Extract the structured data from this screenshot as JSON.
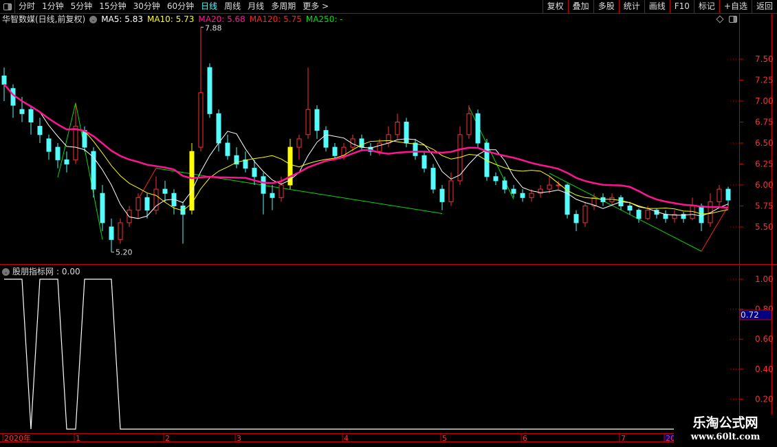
{
  "toolbar": {
    "periods": [
      "分时",
      "1分钟",
      "5分钟",
      "15分钟",
      "30分钟",
      "60分钟",
      "日线",
      "周线",
      "月线",
      "多周期",
      "更多 >"
    ],
    "active_period": "日线",
    "actions": [
      "复权",
      "叠加",
      "多股",
      "统计",
      "画线",
      "F10",
      "标记",
      "+自选",
      "返回"
    ]
  },
  "header": {
    "title": "华智数媒(日线,前复权)",
    "ma": [
      {
        "label": "MA5: 5.83",
        "color": "#ffffff"
      },
      {
        "label": "MA10: 5.73",
        "color": "#ffff00"
      },
      {
        "label": "MA20: 5.68",
        "color": "#ff1493"
      },
      {
        "label": "MA120: 5.75",
        "color": "#ff2020"
      },
      {
        "label": "MA250: -",
        "color": "#00e000"
      }
    ]
  },
  "indicator": {
    "title": "股朋指标网",
    "value": ": 0.00",
    "current_label": "0.72",
    "values": [
      1,
      1,
      1,
      0,
      1,
      1,
      1,
      0,
      0,
      1,
      1,
      1,
      1,
      0,
      0,
      0,
      0,
      0,
      0,
      0,
      0,
      0,
      0,
      0,
      0,
      0,
      0,
      0,
      0,
      0,
      0,
      0,
      0,
      0,
      0,
      0,
      0,
      0,
      0,
      0,
      0,
      0,
      0,
      0,
      0,
      0,
      0,
      0,
      0,
      0,
      0,
      0,
      0,
      0,
      0,
      0,
      0,
      0,
      0,
      0,
      0,
      0,
      0,
      0,
      0,
      0,
      0,
      0,
      0,
      0,
      0,
      0,
      0,
      0,
      0,
      0,
      0,
      0,
      0,
      0,
      0,
      0
    ],
    "ticks": [
      1.0,
      0.8,
      0.6,
      0.4,
      0.2
    ]
  },
  "chart_data": {
    "type": "candlestick",
    "price_ticks": [
      7.5,
      7.25,
      7.0,
      6.75,
      6.5,
      6.25,
      6.0,
      5.75,
      5.5
    ],
    "ylim": [
      5.08,
      7.96
    ],
    "time_labels": [
      {
        "label": "2020年",
        "i": 0
      },
      {
        "label": "1",
        "i": 8
      },
      {
        "label": "2",
        "i": 18
      },
      {
        "label": "3",
        "i": 26
      },
      {
        "label": "4",
        "i": 38
      },
      {
        "label": "5",
        "i": 49
      },
      {
        "label": "6",
        "i": 58
      },
      {
        "label": "7",
        "i": 69
      },
      {
        "label": "20",
        "i": 74
      }
    ],
    "annotations": [
      {
        "label": "7.88",
        "i": 22,
        "price": 7.88
      },
      {
        "label": "5.20",
        "i": 12,
        "price": 5.2
      }
    ],
    "highlight_candles": [
      21,
      32
    ],
    "candles": [
      [
        7.3,
        7.4,
        7.0,
        7.2
      ],
      [
        7.15,
        7.2,
        6.8,
        6.95
      ],
      [
        6.9,
        7.05,
        6.75,
        6.85
      ],
      [
        6.9,
        6.95,
        6.6,
        6.75
      ],
      [
        6.7,
        6.8,
        6.5,
        6.6
      ],
      [
        6.55,
        6.6,
        6.3,
        6.4
      ],
      [
        6.45,
        6.5,
        6.2,
        6.3
      ],
      [
        6.3,
        6.4,
        6.15,
        6.25
      ],
      [
        6.3,
        6.97,
        6.25,
        6.7
      ],
      [
        6.65,
        6.7,
        6.4,
        6.45
      ],
      [
        6.4,
        6.45,
        5.85,
        5.95
      ],
      [
        5.9,
        6.0,
        5.45,
        5.55
      ],
      [
        5.5,
        5.6,
        5.2,
        5.35
      ],
      [
        5.35,
        5.6,
        5.3,
        5.55
      ],
      [
        5.55,
        5.75,
        5.5,
        5.7
      ],
      [
        5.7,
        5.9,
        5.6,
        5.85
      ],
      [
        5.85,
        5.9,
        5.6,
        5.7
      ],
      [
        5.7,
        6.1,
        5.65,
        5.95
      ],
      [
        5.95,
        6.05,
        5.8,
        5.9
      ],
      [
        5.9,
        5.95,
        5.65,
        5.75
      ],
      [
        5.75,
        5.8,
        5.3,
        5.65
      ],
      [
        5.7,
        6.5,
        5.65,
        6.4
      ],
      [
        6.45,
        7.88,
        6.4,
        7.1
      ],
      [
        7.4,
        7.45,
        6.8,
        6.85
      ],
      [
        6.85,
        6.9,
        6.4,
        6.5
      ],
      [
        6.5,
        6.6,
        6.3,
        6.35
      ],
      [
        6.35,
        6.45,
        6.2,
        6.25
      ],
      [
        6.3,
        6.4,
        6.15,
        6.2
      ],
      [
        6.2,
        6.3,
        6.0,
        6.1
      ],
      [
        6.1,
        6.15,
        5.65,
        5.9
      ],
      [
        5.9,
        6.0,
        5.7,
        5.85
      ],
      [
        5.85,
        6.1,
        5.8,
        6.0
      ],
      [
        6.0,
        6.55,
        5.95,
        6.45
      ],
      [
        6.45,
        6.6,
        6.3,
        6.55
      ],
      [
        6.6,
        7.4,
        6.55,
        6.9
      ],
      [
        6.9,
        6.95,
        6.55,
        6.65
      ],
      [
        6.65,
        6.7,
        6.4,
        6.45
      ],
      [
        6.45,
        6.5,
        6.3,
        6.35
      ],
      [
        6.35,
        6.5,
        6.3,
        6.45
      ],
      [
        6.45,
        6.6,
        6.4,
        6.55
      ],
      [
        6.55,
        6.6,
        6.4,
        6.45
      ],
      [
        6.45,
        6.5,
        6.35,
        6.4
      ],
      [
        6.4,
        6.55,
        6.35,
        6.5
      ],
      [
        6.5,
        6.7,
        6.45,
        6.6
      ],
      [
        6.6,
        6.85,
        6.55,
        6.75
      ],
      [
        6.75,
        6.8,
        6.45,
        6.5
      ],
      [
        6.5,
        6.55,
        6.3,
        6.35
      ],
      [
        6.35,
        6.4,
        6.15,
        6.2
      ],
      [
        6.2,
        6.25,
        5.9,
        5.95
      ],
      [
        5.95,
        6.0,
        5.7,
        5.8
      ],
      [
        5.8,
        6.15,
        5.75,
        6.05
      ],
      [
        6.05,
        6.7,
        6.0,
        6.6
      ],
      [
        6.6,
        6.95,
        6.55,
        6.85
      ],
      [
        6.85,
        6.9,
        6.45,
        6.5
      ],
      [
        6.5,
        6.55,
        6.05,
        6.1
      ],
      [
        6.1,
        6.15,
        6.0,
        6.05
      ],
      [
        6.05,
        6.1,
        5.9,
        5.95
      ],
      [
        5.95,
        6.0,
        5.85,
        5.9
      ],
      [
        5.9,
        5.95,
        5.8,
        5.85
      ],
      [
        5.85,
        5.95,
        5.8,
        5.9
      ],
      [
        5.9,
        6.0,
        5.85,
        5.95
      ],
      [
        5.95,
        6.1,
        5.9,
        6.0
      ],
      [
        6.0,
        6.05,
        5.95,
        6.0
      ],
      [
        6.0,
        6.02,
        5.6,
        5.65
      ],
      [
        5.65,
        5.7,
        5.45,
        5.55
      ],
      [
        5.55,
        5.8,
        5.5,
        5.75
      ],
      [
        5.75,
        5.9,
        5.7,
        5.85
      ],
      [
        5.85,
        5.9,
        5.75,
        5.8
      ],
      [
        5.8,
        5.9,
        5.75,
        5.85
      ],
      [
        5.85,
        5.88,
        5.7,
        5.75
      ],
      [
        5.75,
        5.8,
        5.65,
        5.7
      ],
      [
        5.7,
        5.72,
        5.55,
        5.6
      ],
      [
        5.6,
        5.75,
        5.58,
        5.7
      ],
      [
        5.7,
        5.72,
        5.6,
        5.65
      ],
      [
        5.65,
        5.7,
        5.55,
        5.6
      ],
      [
        5.6,
        5.7,
        5.55,
        5.65
      ],
      [
        5.65,
        5.68,
        5.55,
        5.6
      ],
      [
        5.6,
        5.85,
        5.58,
        5.75
      ],
      [
        5.75,
        5.78,
        5.45,
        5.55
      ],
      [
        5.55,
        5.9,
        5.5,
        5.8
      ],
      [
        5.8,
        6.0,
        5.75,
        5.95
      ],
      [
        5.95,
        5.98,
        5.75,
        5.82
      ]
    ],
    "zigzag": [
      {
        "color": "#00e000",
        "points": [
          [
            6,
            6.09
          ],
          [
            8,
            6.98
          ],
          [
            11,
            5.35
          ]
        ]
      },
      {
        "color": "#ff2020",
        "points": [
          [
            15,
            5.83
          ],
          [
            17,
            6.2
          ]
        ]
      },
      {
        "color": "#00e000",
        "points": [
          [
            17,
            6.2
          ],
          [
            49,
            5.66
          ]
        ]
      },
      {
        "color": "#00e000",
        "points": [
          [
            52,
            6.93
          ],
          [
            57,
            5.83
          ]
        ]
      },
      {
        "color": "#00e000",
        "points": [
          [
            61,
            6.14
          ],
          [
            78,
            5.21
          ]
        ]
      },
      {
        "color": "#ff2020",
        "points": [
          [
            78,
            5.21
          ],
          [
            81,
            5.75
          ]
        ]
      }
    ],
    "colors": {
      "up": "#ff3030",
      "down": "#54fcfc",
      "highlight": "#ffff00",
      "ma5": "#ffffff",
      "ma10": "#ffff00",
      "ma20": "#ff1493",
      "axis": "#cc0000",
      "tick_text": "#ff3030"
    }
  },
  "watermark": {
    "line1": "乐淘公式网",
    "line2": "www.60lt.com"
  }
}
